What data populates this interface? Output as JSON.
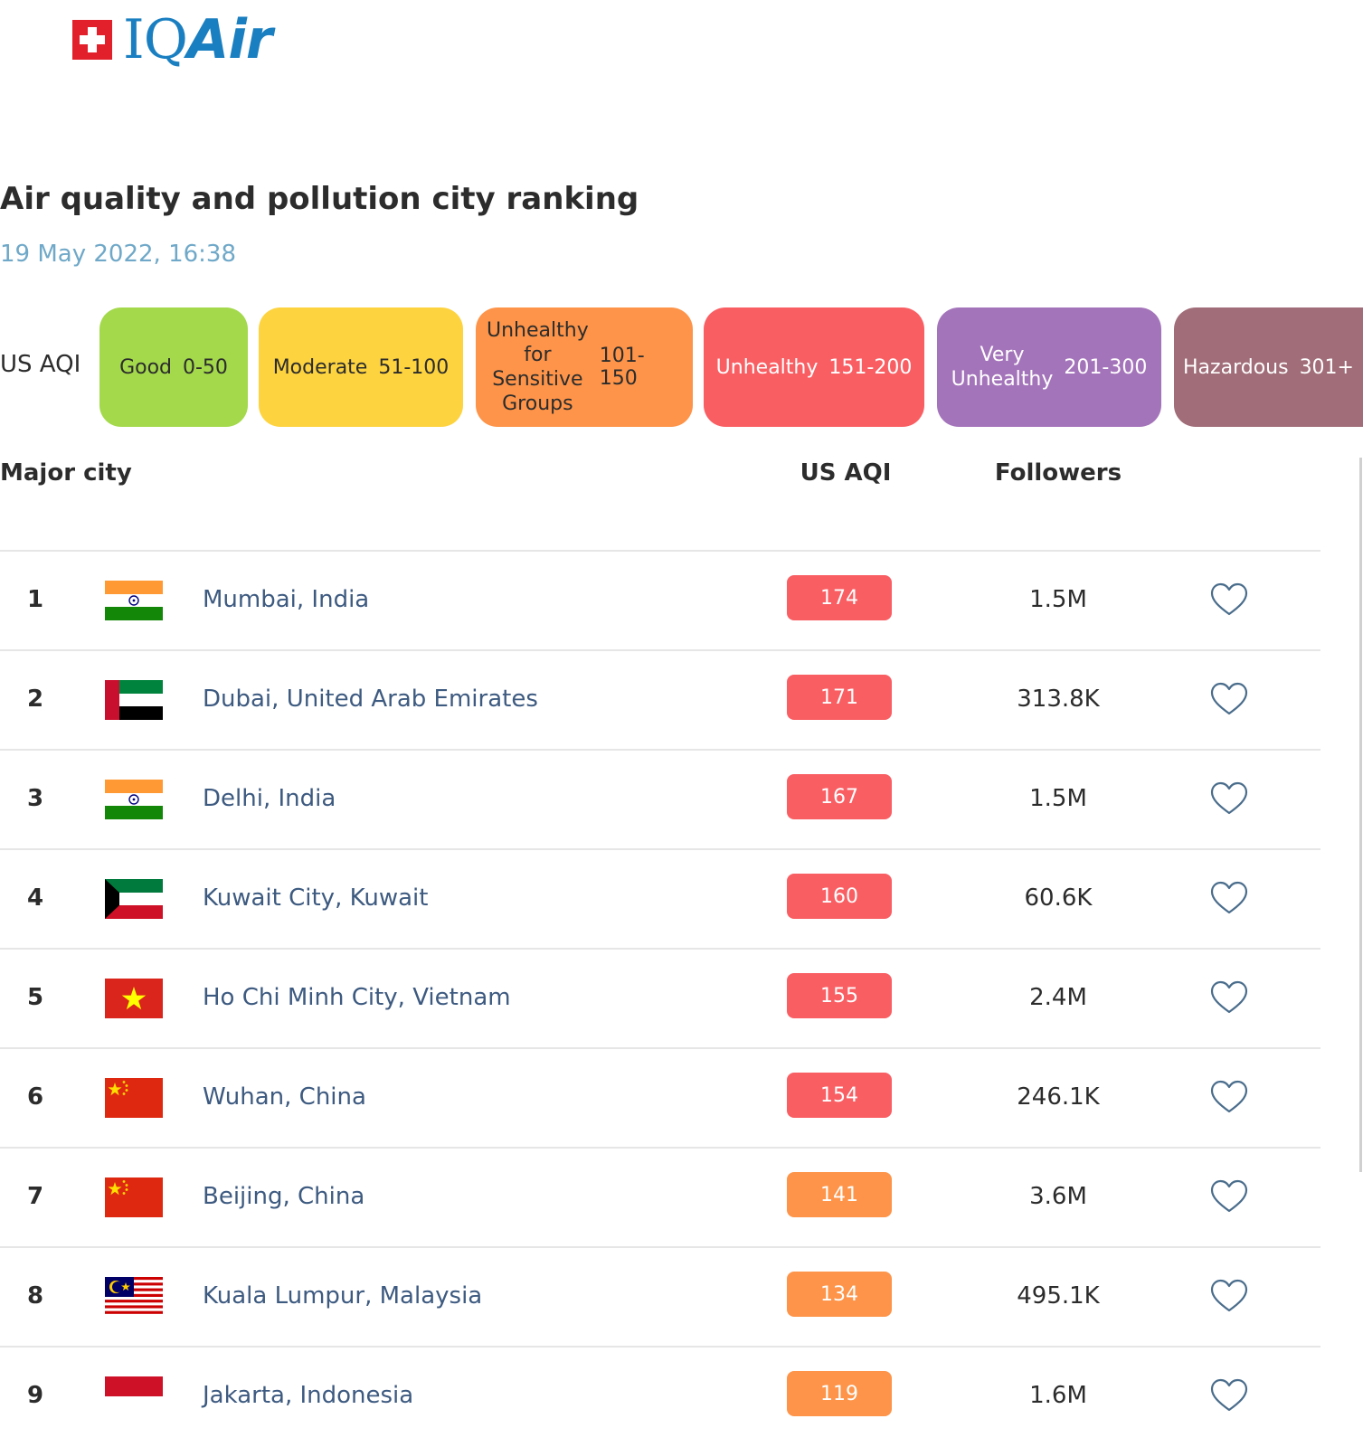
{
  "brand": {
    "name": "IQAir",
    "name_prefix": "IQ",
    "name_suffix": "Air"
  },
  "page": {
    "title": "Air quality and pollution city ranking",
    "timestamp": "19 May 2022, 16:38"
  },
  "legend": {
    "label": "US AQI",
    "items": [
      {
        "name": "Good",
        "range": "0-50",
        "color": "#a3d94b"
      },
      {
        "name": "Moderate",
        "range": "51-100",
        "color": "#fdd33f"
      },
      {
        "name": "Unhealthy for Sensitive Groups",
        "name_lines": [
          "Unhealthy",
          "for",
          "Sensitive",
          "Groups"
        ],
        "range": "101-150",
        "color": "#fd9449"
      },
      {
        "name": "Unhealthy",
        "range": "151-200",
        "color": "#f95e63"
      },
      {
        "name": "Very Unhealthy",
        "name_lines": [
          "Very",
          "Unhealthy"
        ],
        "range": "201-300",
        "color": "#a474ba"
      },
      {
        "name": "Hazardous",
        "range": "301+",
        "color": "#a06d78"
      }
    ]
  },
  "table": {
    "headers": {
      "city": "Major city",
      "aqi": "US AQI",
      "followers": "Followers"
    },
    "rows": [
      {
        "rank": "1",
        "city": "Mumbai, India",
        "aqi": "174",
        "followers": "1.5M",
        "flag": "india-flag",
        "aqi_color": "#f95e63"
      },
      {
        "rank": "2",
        "city": "Dubai, United Arab Emirates",
        "aqi": "171",
        "followers": "313.8K",
        "flag": "uae-flag",
        "aqi_color": "#f95e63"
      },
      {
        "rank": "3",
        "city": "Delhi, India",
        "aqi": "167",
        "followers": "1.5M",
        "flag": "india-flag",
        "aqi_color": "#f95e63"
      },
      {
        "rank": "4",
        "city": "Kuwait City, Kuwait",
        "aqi": "160",
        "followers": "60.6K",
        "flag": "kuwait-flag",
        "aqi_color": "#f95e63"
      },
      {
        "rank": "5",
        "city": "Ho Chi Minh City, Vietnam",
        "aqi": "155",
        "followers": "2.4M",
        "flag": "vietnam-flag",
        "aqi_color": "#f95e63"
      },
      {
        "rank": "6",
        "city": "Wuhan, China",
        "aqi": "154",
        "followers": "246.1K",
        "flag": "china-flag",
        "aqi_color": "#f95e63"
      },
      {
        "rank": "7",
        "city": "Beijing, China",
        "aqi": "141",
        "followers": "3.6M",
        "flag": "china-flag",
        "aqi_color": "#fd9449"
      },
      {
        "rank": "8",
        "city": "Kuala Lumpur, Malaysia",
        "aqi": "134",
        "followers": "495.1K",
        "flag": "malaysia-flag",
        "aqi_color": "#fd9449"
      },
      {
        "rank": "9",
        "city": "Jakarta, Indonesia",
        "aqi": "119",
        "followers": "1.6M",
        "flag": "indonesia-flag",
        "aqi_color": "#fd9449"
      }
    ]
  }
}
